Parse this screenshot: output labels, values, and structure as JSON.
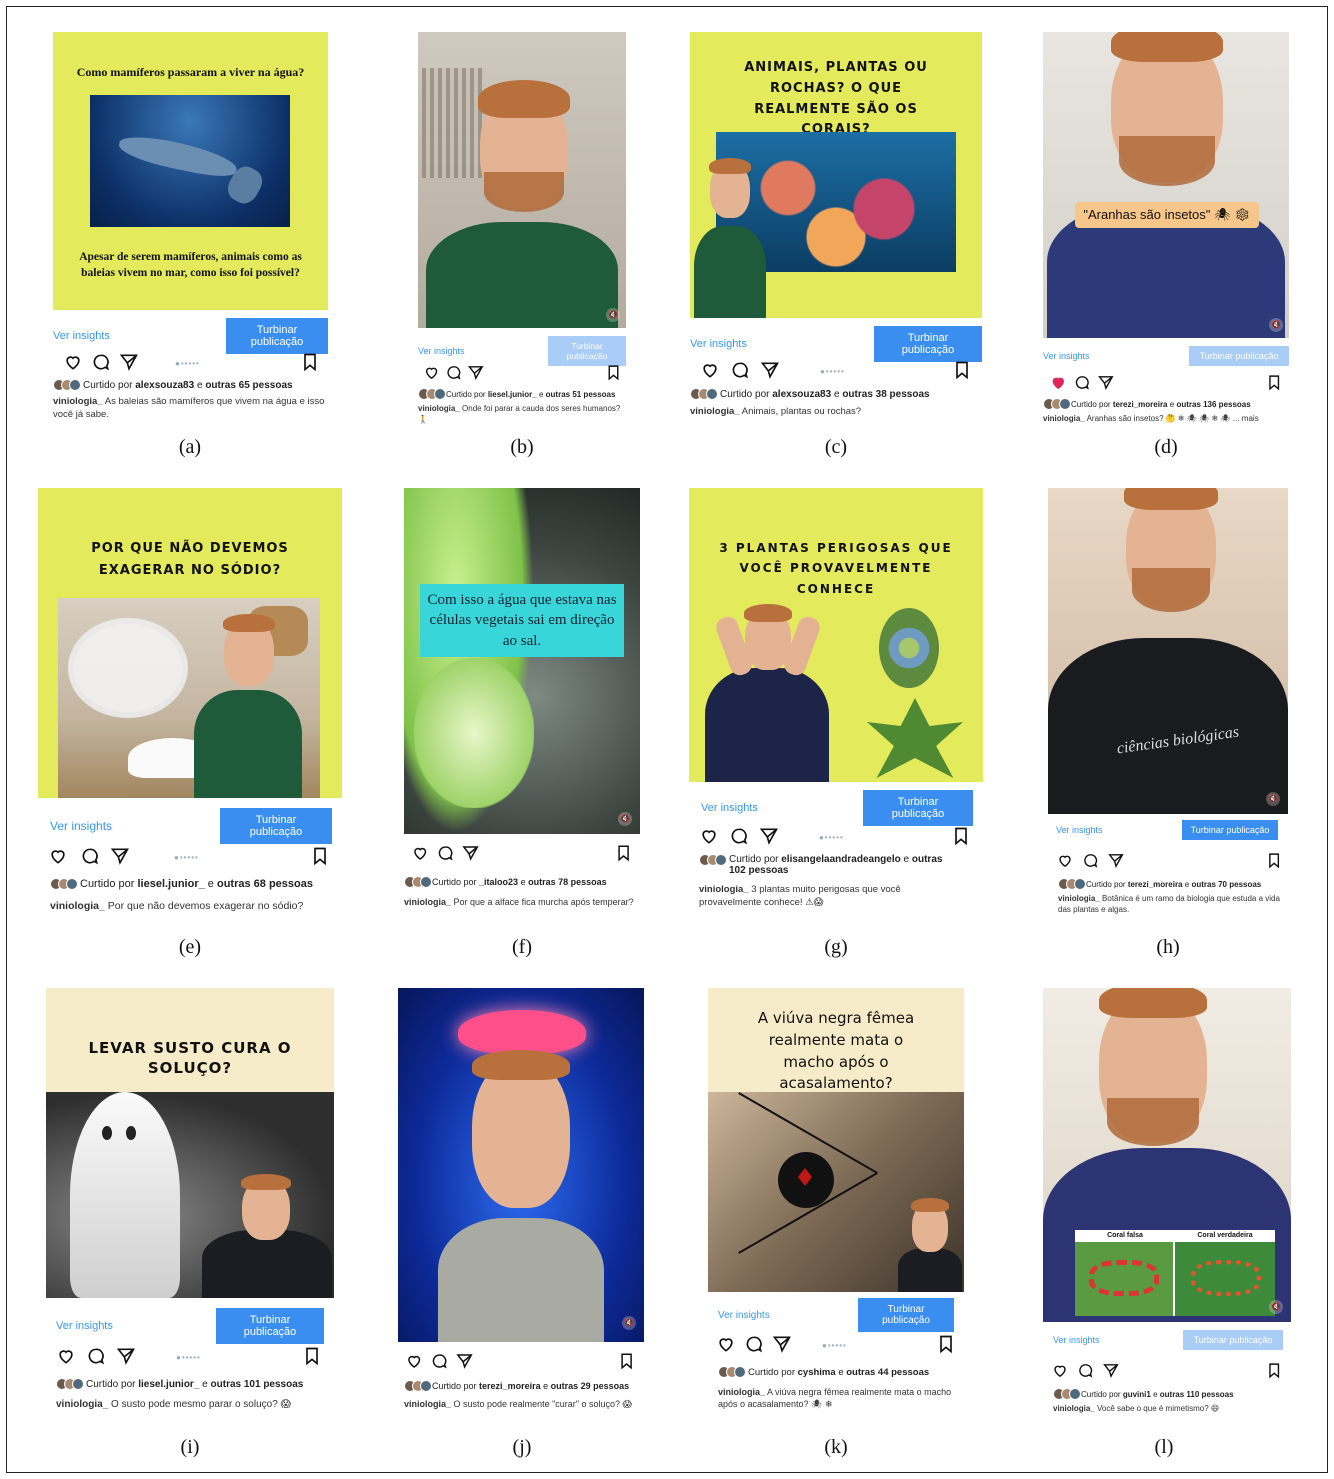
{
  "common": {
    "insights_label": "Ver insights",
    "boost_label": "Turbinar publicação",
    "icons": [
      "heart-icon",
      "comment-icon",
      "share-icon",
      "bookmark-icon"
    ]
  },
  "panels": [
    {
      "letter": "(a)",
      "title": "Como mamíferos passaram a viver na água?",
      "subtitle": "Apesar de serem mamíferos, animais como as baleias vivem no mar, como isso foi possível?",
      "liked_by": "alexsouza83",
      "likes_others": "outras 65 pessoas",
      "caption_user": "viniologia_",
      "caption": "As baleias são mamíferos que vivem na água e isso você já sabe."
    },
    {
      "letter": "(b)",
      "liked_by": "liesel.junior_",
      "likes_others": "outras 51 pessoas",
      "caption_user": "viniologia_",
      "caption": "Onde foi parar a cauda dos seres humanos? 🚶"
    },
    {
      "letter": "(c)",
      "title": "ANIMAIS, PLANTAS OU ROCHAS? O QUE REALMENTE SÃO OS CORAIS?",
      "liked_by": "alexsouza83",
      "likes_others": "outras 38 pessoas",
      "caption_user": "viniologia_",
      "caption": "Animais, plantas ou rochas?"
    },
    {
      "letter": "(d)",
      "overlay": "\"Aranhas são insetos\" 🕷 ❄",
      "liked_by": "terezi_moreira",
      "likes_others": "outras 136 pessoas",
      "caption_user": "viniologia_",
      "caption": "Aranhas são insetos? 🤔 ❄ 🕷 🕷 ❄ 🕷 ... mais"
    },
    {
      "letter": "(e)",
      "title": "POR QUE NÃO DEVEMOS EXAGERAR NO SÓDIO?",
      "liked_by": "liesel.junior_",
      "likes_others": "outras 68 pessoas",
      "caption_user": "viniologia_",
      "caption": "Por que não devemos exagerar no sódio?"
    },
    {
      "letter": "(f)",
      "overlay": "Com isso a água que estava nas células vegetais sai em direção ao sal.",
      "liked_by": "_italoo23",
      "likes_others": "outras 78 pessoas",
      "caption_user": "viniologia_",
      "caption": "Por que a alface fica murcha após temperar?"
    },
    {
      "letter": "(g)",
      "title": "3 PLANTAS PERIGOSAS QUE VOCÊ PROVAVELMENTE CONHECE",
      "liked_by": "elisangelaandradeangelo",
      "likes_others": "outras 102 pessoas",
      "caption_user": "viniologia_",
      "caption": "3 plantas muito perigosas que você provavelmente conhece! ⚠😱"
    },
    {
      "letter": "(h)",
      "shirt_text": "ciências biológicas",
      "liked_by": "terezi_moreira",
      "likes_others": "outras 70 pessoas",
      "caption_user": "viniologia_",
      "caption": "Botânica é um ramo da biologia que estuda a vida das plantas e algas."
    },
    {
      "letter": "(i)",
      "title": "LEVAR SUSTO CURA O SOLUÇO?",
      "liked_by": "liesel.junior_",
      "likes_others": "outras 101 pessoas",
      "caption_user": "viniologia_",
      "caption": "O susto pode mesmo parar o soluço? 😱"
    },
    {
      "letter": "(j)",
      "liked_by": "terezi_moreira",
      "likes_others": "outras 29 pessoas",
      "caption_user": "viniologia_",
      "caption": "O susto pode realmente \"curar\" o soluço? 😱"
    },
    {
      "letter": "(k)",
      "title": "A viúva negra fêmea realmente mata o macho após o acasalamento?",
      "liked_by": "cyshima",
      "likes_others": "outras 44 pessoas",
      "caption_user": "viniologia_",
      "caption": "A viúva negra fêmea realmente mata o macho após o acasalamento? 🕷 ❄"
    },
    {
      "letter": "(l)",
      "label_left": "Coral falsa",
      "label_right": "Coral verdadeira",
      "liked_by": "guvini1",
      "likes_others": "outras 110 pessoas",
      "caption_user": "viniologia_",
      "caption": "Você sabe o que é mimetismo? 😄"
    }
  ],
  "connector": "e",
  "liked_prefix": "Curtido por",
  "colors": {
    "yellow": "#e3ea5c",
    "cream": "#f7ecc9",
    "boost": "#3a8ef0",
    "insight": "#3897f0",
    "like_red": "#e0245e"
  }
}
